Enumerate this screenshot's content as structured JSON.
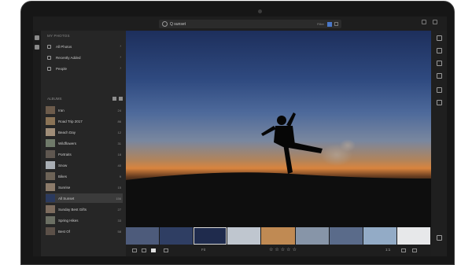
{
  "app": {
    "accent": "#4a78c9"
  },
  "search": {
    "value": "Q sunset",
    "filter_label": "Filter"
  },
  "sidebar": {
    "section_title": "MY PHOTOS",
    "items": [
      {
        "label": "All Photos",
        "icon": "photos-icon"
      },
      {
        "label": "Recently Added",
        "icon": "clock-icon"
      },
      {
        "label": "People",
        "icon": "people-icon"
      }
    ],
    "albums_title": "ALBUMS",
    "albums": [
      {
        "name": "Iran",
        "count": "24",
        "thumb": "#6c5b4b"
      },
      {
        "name": "Road Trip 2017",
        "count": "86",
        "thumb": "#8a7356"
      },
      {
        "name": "Beach Day",
        "count": "12",
        "thumb": "#9f8d78"
      },
      {
        "name": "Wildflowers",
        "count": "31",
        "thumb": "#6f7a6a"
      },
      {
        "name": "Portraits",
        "count": "18",
        "thumb": "#5f5750"
      },
      {
        "name": "Snow",
        "count": "40",
        "thumb": "#a9aeb4"
      },
      {
        "name": "Bikes",
        "count": "9",
        "thumb": "#6d6357"
      },
      {
        "name": "Sunrise",
        "count": "15",
        "thumb": "#8c7b6a"
      },
      {
        "name": "All Sunset",
        "count": "156",
        "thumb": "#2b3a5e",
        "selected": true
      },
      {
        "name": "Sunday Best Gifts",
        "count": "27",
        "thumb": "#7d6c5e"
      },
      {
        "name": "Spring Hikes",
        "count": "33",
        "thumb": "#6b6f63"
      },
      {
        "name": "Best Of",
        "count": "58",
        "thumb": "#5b5048"
      }
    ]
  },
  "filmstrip": [
    {
      "color": "#4d5b7b"
    },
    {
      "color": "#2f3e63"
    },
    {
      "color": "#1f2b4d",
      "selected": true
    },
    {
      "color": "#bfc6cf"
    },
    {
      "color": "#c08a53"
    },
    {
      "color": "#8795a8"
    },
    {
      "color": "#5a6b8a"
    },
    {
      "color": "#93abc6"
    },
    {
      "color": "#e7e8ea"
    }
  ],
  "bottombar": {
    "fit_label": "Fit",
    "stars": [
      "☆",
      "☆",
      "☆",
      "☆",
      "☆"
    ],
    "zoom_label": "1:1"
  }
}
